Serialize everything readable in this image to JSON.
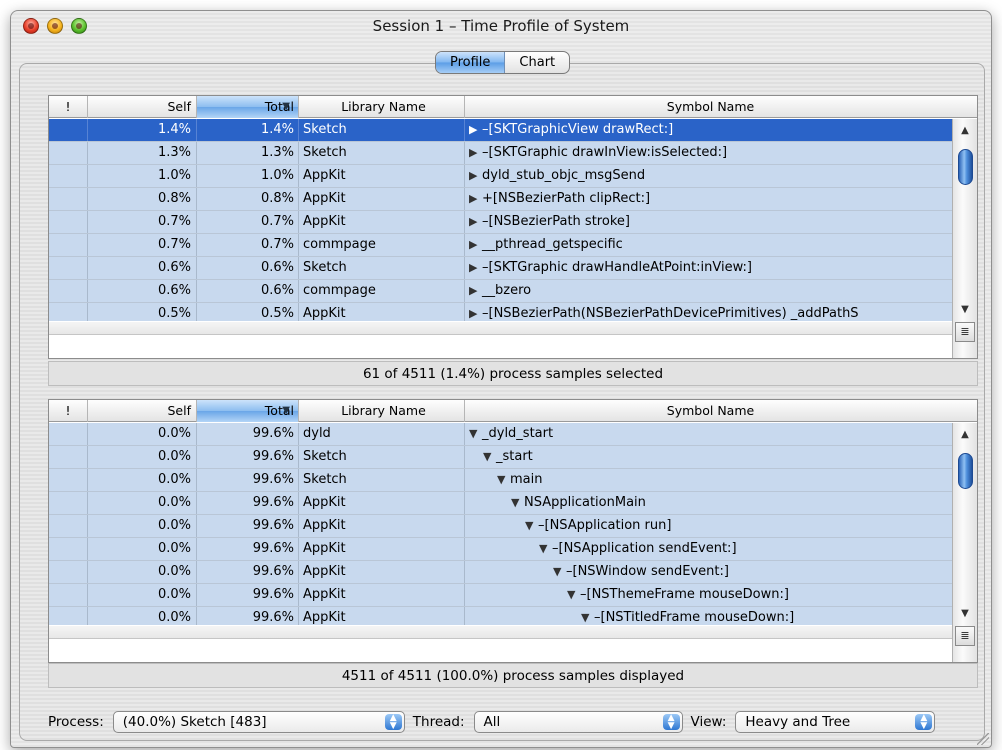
{
  "window": {
    "title": "Session 1 – Time Profile of System"
  },
  "tabs": [
    {
      "label": "Profile",
      "active": true
    },
    {
      "label": "Chart",
      "active": false
    }
  ],
  "columns": {
    "excl": "!",
    "self": "Self",
    "total": "Total",
    "library": "Library Name",
    "symbol": "Symbol Name"
  },
  "top_table": {
    "rows": [
      {
        "self": "1.4%",
        "total": "1.4%",
        "library": "Sketch",
        "symbol": "–[SKTGraphicView drawRect:]",
        "expander": "▶",
        "indent": 0,
        "selected": true
      },
      {
        "self": "1.3%",
        "total": "1.3%",
        "library": "Sketch",
        "symbol": "–[SKTGraphic drawInView:isSelected:]",
        "expander": "▶",
        "indent": 0
      },
      {
        "self": "1.0%",
        "total": "1.0%",
        "library": "AppKit",
        "symbol": "dyld_stub_objc_msgSend",
        "expander": "▶",
        "indent": 0
      },
      {
        "self": "0.8%",
        "total": "0.8%",
        "library": "AppKit",
        "symbol": "+[NSBezierPath clipRect:]",
        "expander": "▶",
        "indent": 0
      },
      {
        "self": "0.7%",
        "total": "0.7%",
        "library": "AppKit",
        "symbol": "–[NSBezierPath stroke]",
        "expander": "▶",
        "indent": 0
      },
      {
        "self": "0.7%",
        "total": "0.7%",
        "library": "commpage",
        "symbol": "__pthread_getspecific",
        "expander": "▶",
        "indent": 0
      },
      {
        "self": "0.6%",
        "total": "0.6%",
        "library": "Sketch",
        "symbol": "–[SKTGraphic drawHandleAtPoint:inView:]",
        "expander": "▶",
        "indent": 0
      },
      {
        "self": "0.6%",
        "total": "0.6%",
        "library": "commpage",
        "symbol": "__bzero",
        "expander": "▶",
        "indent": 0
      },
      {
        "self": "0.5%",
        "total": "0.5%",
        "library": "AppKit",
        "symbol": "–[NSBezierPath(NSBezierPathDevicePrimitives) _addPathS",
        "expander": "▶",
        "indent": 0
      }
    ]
  },
  "top_status": "61 of 4511 (1.4%) process samples selected",
  "bottom_table": {
    "rows": [
      {
        "self": "0.0%",
        "total": "99.6%",
        "library": "dyld",
        "symbol": "_dyld_start",
        "expander": "▼",
        "indent": 0
      },
      {
        "self": "0.0%",
        "total": "99.6%",
        "library": "Sketch",
        "symbol": "_start",
        "expander": "▼",
        "indent": 1
      },
      {
        "self": "0.0%",
        "total": "99.6%",
        "library": "Sketch",
        "symbol": "main",
        "expander": "▼",
        "indent": 2
      },
      {
        "self": "0.0%",
        "total": "99.6%",
        "library": "AppKit",
        "symbol": "NSApplicationMain",
        "expander": "▼",
        "indent": 3
      },
      {
        "self": "0.0%",
        "total": "99.6%",
        "library": "AppKit",
        "symbol": "–[NSApplication run]",
        "expander": "▼",
        "indent": 4
      },
      {
        "self": "0.0%",
        "total": "99.6%",
        "library": "AppKit",
        "symbol": "–[NSApplication sendEvent:]",
        "expander": "▼",
        "indent": 5
      },
      {
        "self": "0.0%",
        "total": "99.6%",
        "library": "AppKit",
        "symbol": "–[NSWindow sendEvent:]",
        "expander": "▼",
        "indent": 6
      },
      {
        "self": "0.0%",
        "total": "99.6%",
        "library": "AppKit",
        "symbol": "–[NSThemeFrame mouseDown:]",
        "expander": "▼",
        "indent": 7
      },
      {
        "self": "0.0%",
        "total": "99.6%",
        "library": "AppKit",
        "symbol": "–[NSTitledFrame mouseDown:]",
        "expander": "▼",
        "indent": 8
      }
    ]
  },
  "bottom_status": "4511 of 4511 (100.0%) process samples displayed",
  "controls": {
    "process_label": "Process:",
    "process_value": "(40.0%) Sketch [483]",
    "thread_label": "Thread:",
    "thread_value": "All",
    "view_label": "View:",
    "view_value": "Heavy and Tree"
  },
  "icons": {
    "close": "close-light",
    "minimize": "minimize-light",
    "zoom": "zoom-light"
  },
  "colors": {
    "selection": "#2a63c8",
    "row": "#c8d9ee",
    "accent": "#5b9de6"
  }
}
